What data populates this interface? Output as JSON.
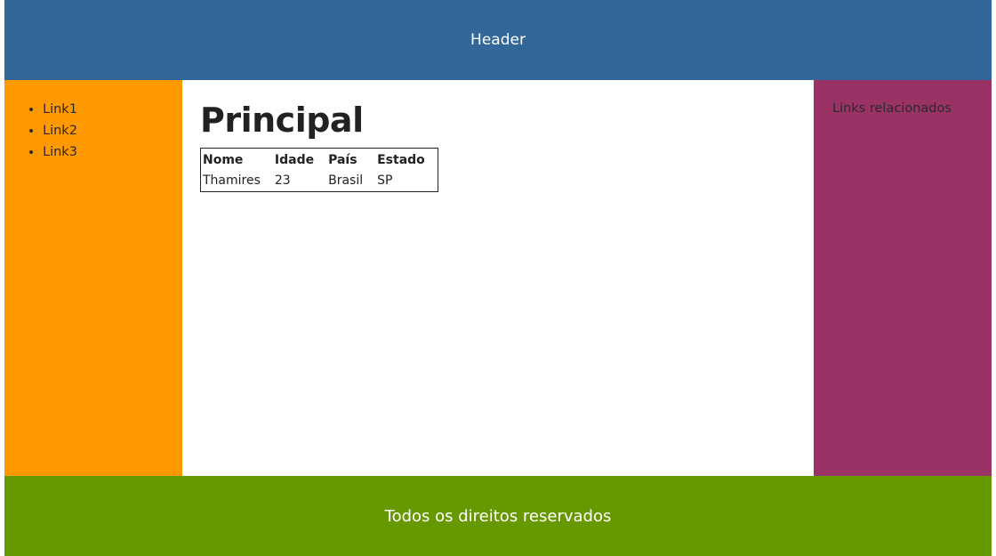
{
  "header": {
    "title": "Header",
    "color": "#336699"
  },
  "sidebar": {
    "color": "#FF9900",
    "links": [
      {
        "label": "Link1"
      },
      {
        "label": "Link2"
      },
      {
        "label": "Link3"
      }
    ]
  },
  "main": {
    "title": "Principal",
    "table": {
      "headers": [
        "Nome",
        "Idade",
        "País",
        "Estado"
      ],
      "rows": [
        [
          "Thamires",
          "23",
          "Brasil",
          "SP"
        ]
      ]
    }
  },
  "aside": {
    "label": "Links relacionados",
    "color": "#993366"
  },
  "footer": {
    "text": "Todos os direitos reservados",
    "color": "#669900"
  }
}
